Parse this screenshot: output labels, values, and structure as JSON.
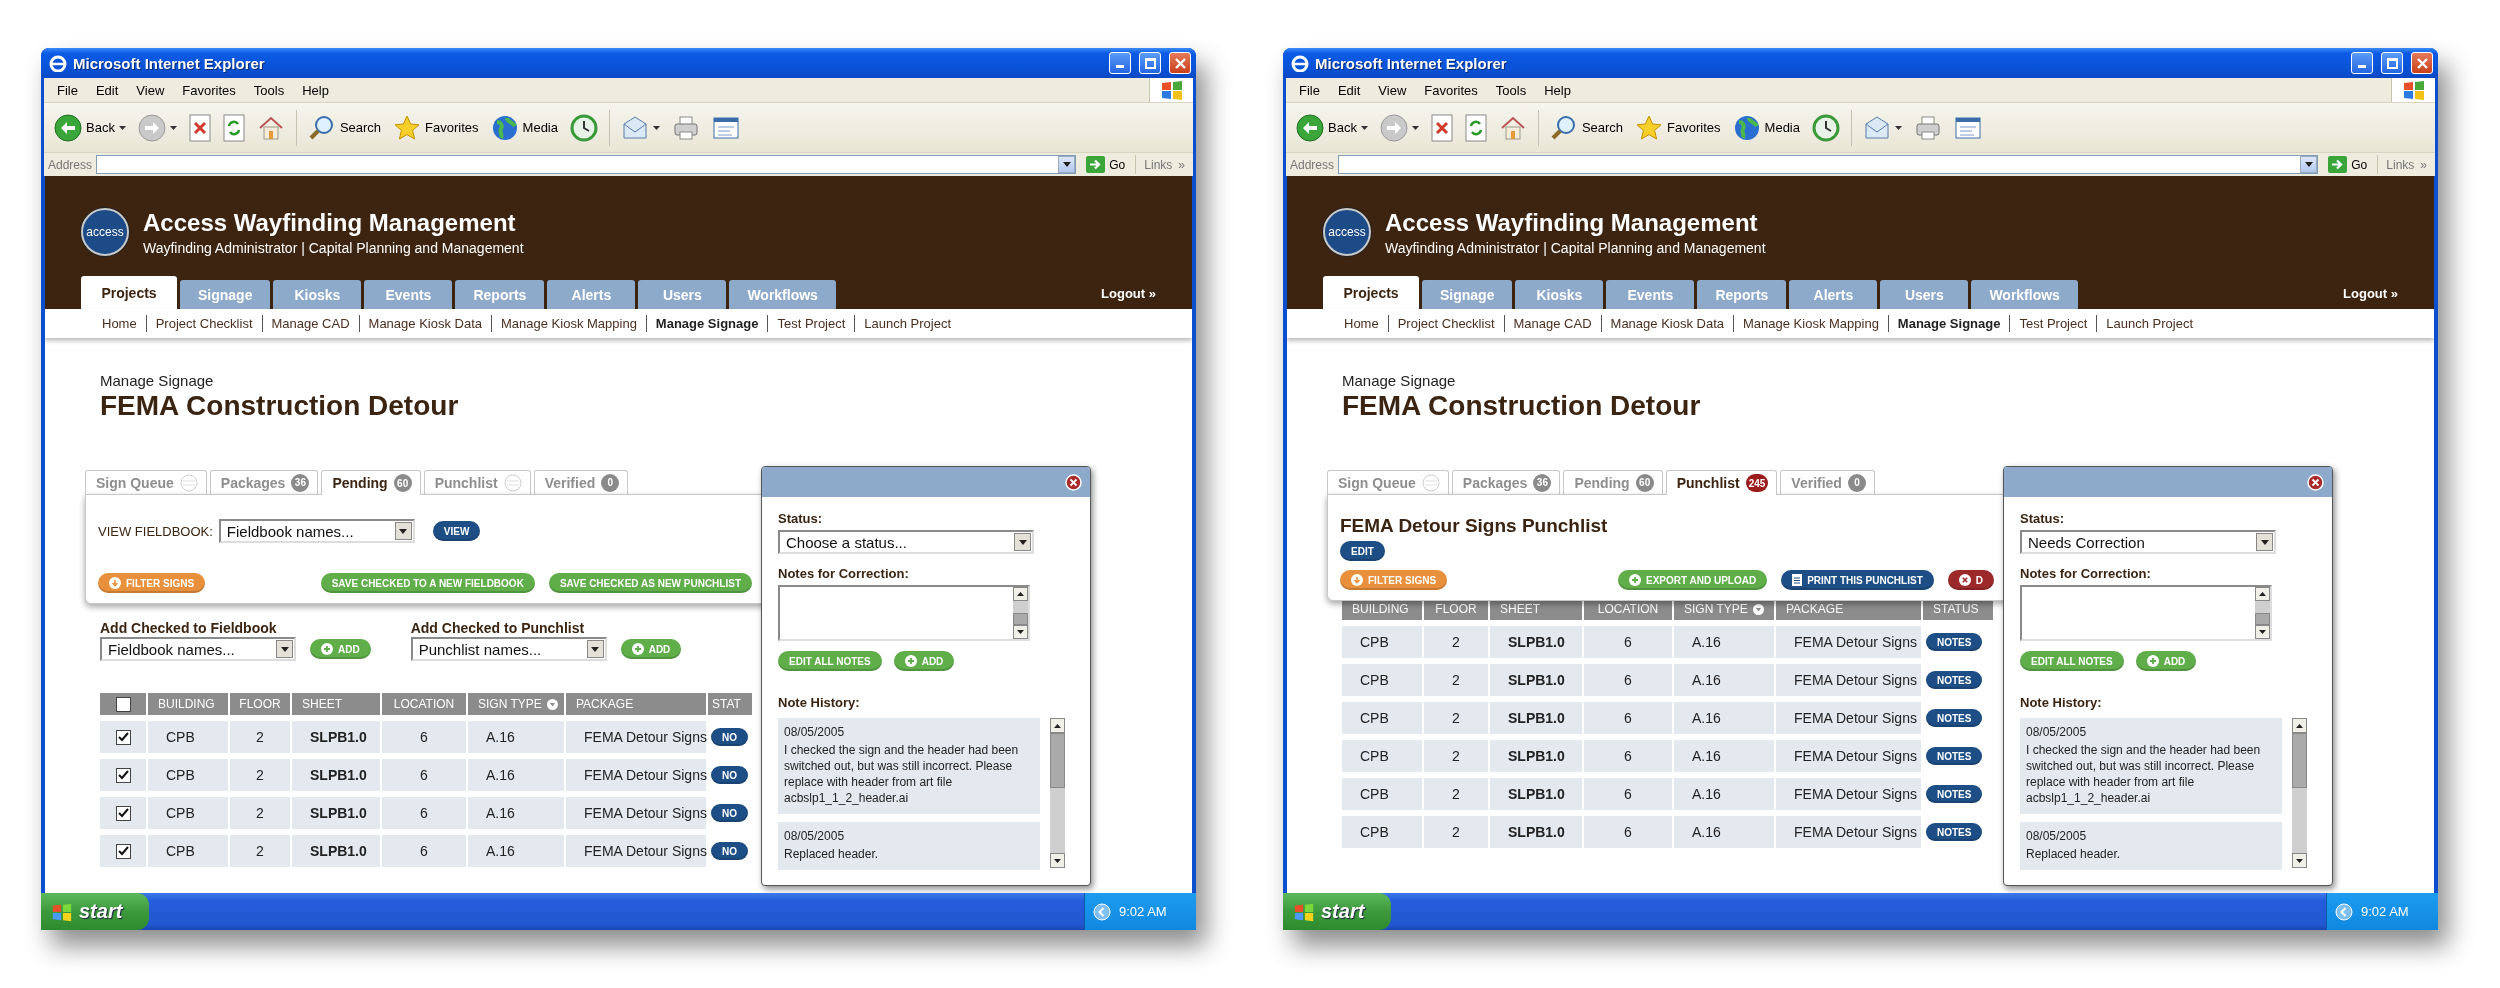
{
  "screens": [
    {
      "window": {
        "title": "Microsoft Internet Explorer"
      },
      "menu": [
        "File",
        "Edit",
        "View",
        "Favorites",
        "Tools",
        "Help"
      ],
      "toolbar": [
        {
          "kind": "back",
          "label": "Back"
        },
        {
          "kind": "forward"
        },
        {
          "kind": "stop"
        },
        {
          "kind": "refresh"
        },
        {
          "kind": "home"
        },
        {
          "kind": "separator"
        },
        {
          "kind": "search",
          "label": "Search"
        },
        {
          "kind": "favorites",
          "label": "Favorites"
        },
        {
          "kind": "media",
          "label": "Media"
        },
        {
          "kind": "history"
        },
        {
          "kind": "separator"
        },
        {
          "kind": "mail"
        },
        {
          "kind": "print"
        },
        {
          "kind": "edit"
        }
      ],
      "address": {
        "label": "Address",
        "go": "Go",
        "links": "Links",
        "more": "»"
      },
      "site": {
        "logo": "access",
        "title": "Access Wayfinding Management",
        "subtitle": "Wayfinding Administrator | Capital Planning and Management",
        "nav": [
          {
            "label": "Projects",
            "selected": true
          },
          {
            "label": "Signage",
            "selected": false
          },
          {
            "label": "Kiosks",
            "selected": false
          },
          {
            "label": "Events",
            "selected": false
          },
          {
            "label": "Reports",
            "selected": false
          },
          {
            "label": "Alerts",
            "selected": false
          },
          {
            "label": "Users",
            "selected": false
          },
          {
            "label": "Workflows",
            "selected": false
          }
        ],
        "logout": "Logout »",
        "subnav": [
          {
            "label": "Home",
            "selected": false
          },
          {
            "label": "Project Checklist",
            "selected": false
          },
          {
            "label": "Manage CAD",
            "selected": false
          },
          {
            "label": "Manage Kiosk Data",
            "selected": false
          },
          {
            "label": "Manage Kiosk Mapping",
            "selected": false
          },
          {
            "label": "Manage Signage",
            "selected": true
          },
          {
            "label": "Test Project",
            "selected": false
          },
          {
            "label": "Launch Project",
            "selected": false
          }
        ]
      },
      "page": {
        "breadcrumb": "Manage Signage",
        "title": "FEMA Construction Detour"
      },
      "tabs": [
        {
          "label": "Sign Queue",
          "selected": false
        },
        {
          "label": "Packages",
          "badge": "36",
          "color": "#8a8a8a",
          "selected": false
        },
        {
          "label": "Pending",
          "badge": "60",
          "color": "#8a8a8a",
          "selected": true
        },
        {
          "label": "Punchlist",
          "selected": false
        },
        {
          "label": "Verified",
          "badge": "0",
          "color": "#8a8a8a",
          "selected": false
        }
      ],
      "panel": {
        "kind": "fieldbook",
        "view_label": "VIEW FIELDBOOK:",
        "select": "Fieldbook names...",
        "view_button": "VIEW",
        "buttons": [
          {
            "kind": "filter",
            "label": "FILTER SIGNS"
          },
          {
            "kind": "save",
            "label": "SAVE CHECKED TO A NEW FIELDBOOK"
          },
          {
            "kind": "save",
            "label": "SAVE CHECKED AS NEW PUNCHLIST"
          }
        ]
      },
      "add_checked": [
        {
          "label": "Add Checked to Fieldbook",
          "select": "Fieldbook names...",
          "button": "ADD"
        },
        {
          "label": "Add Checked to Punchlist",
          "select": "Punchlist names...",
          "button": "ADD"
        }
      ],
      "table": {
        "select_all": {
          "checked": false
        },
        "columns": [
          {
            "label": "BUILDING",
            "sorted": false
          },
          {
            "label": "FLOOR",
            "sorted": false
          },
          {
            "label": "SHEET",
            "sorted": false
          },
          {
            "label": "LOCATION",
            "sorted": false
          },
          {
            "label": "SIGN TYPE",
            "sorted": true
          },
          {
            "label": "PACKAGE",
            "sorted": false
          },
          {
            "label": "STAT",
            "sorted": false
          }
        ],
        "rows": [
          {
            "checked": true,
            "cells": [
              "CPB",
              "2",
              "SLPB1.0",
              "6",
              "A.16",
              "FEMA Detour Signs"
            ],
            "status": "NO"
          },
          {
            "checked": true,
            "cells": [
              "CPB",
              "2",
              "SLPB1.0",
              "6",
              "A.16",
              "FEMA Detour Signs"
            ],
            "status": "NO"
          },
          {
            "checked": true,
            "cells": [
              "CPB",
              "2",
              "SLPB1.0",
              "6",
              "A.16",
              "FEMA Detour Signs"
            ],
            "status": "NO"
          },
          {
            "checked": true,
            "cells": [
              "CPB",
              "2",
              "SLPB1.0",
              "6",
              "A.16",
              "FEMA Detour Signs"
            ],
            "status": "NO"
          }
        ]
      },
      "popup": {
        "status_label": "Status:",
        "status_value": "Choose a status...",
        "notes_label": "Notes for Correction:",
        "buttons": [
          {
            "kind": "save",
            "label": "EDIT ALL NOTES"
          },
          {
            "kind": "add",
            "label": "ADD"
          }
        ],
        "history_label": "Note History:",
        "notes": [
          {
            "date": "08/05/2005",
            "text": "I checked the sign and the header had been switched out, but was still incorrect. Please replace with header from art file acbslp1_1_2_header.ai"
          },
          {
            "date": "08/05/2005",
            "text": "Replaced header."
          }
        ]
      },
      "taskbar": {
        "start": "start",
        "clock": "9:02 AM"
      }
    },
    {
      "window": {
        "title": "Microsoft Internet Explorer"
      },
      "menu": [
        "File",
        "Edit",
        "View",
        "Favorites",
        "Tools",
        "Help"
      ],
      "toolbar": [
        {
          "kind": "back",
          "label": "Back"
        },
        {
          "kind": "forward"
        },
        {
          "kind": "stop"
        },
        {
          "kind": "refresh"
        },
        {
          "kind": "home"
        },
        {
          "kind": "separator"
        },
        {
          "kind": "search",
          "label": "Search"
        },
        {
          "kind": "favorites",
          "label": "Favorites"
        },
        {
          "kind": "media",
          "label": "Media"
        },
        {
          "kind": "history"
        },
        {
          "kind": "separator"
        },
        {
          "kind": "mail"
        },
        {
          "kind": "print"
        },
        {
          "kind": "edit"
        }
      ],
      "address": {
        "label": "Address",
        "go": "Go",
        "links": "Links",
        "more": "»"
      },
      "site": {
        "logo": "access",
        "title": "Access Wayfinding Management",
        "subtitle": "Wayfinding Administrator | Capital Planning and Management",
        "nav": [
          {
            "label": "Projects",
            "selected": true
          },
          {
            "label": "Signage",
            "selected": false
          },
          {
            "label": "Kiosks",
            "selected": false
          },
          {
            "label": "Events",
            "selected": false
          },
          {
            "label": "Reports",
            "selected": false
          },
          {
            "label": "Alerts",
            "selected": false
          },
          {
            "label": "Users",
            "selected": false
          },
          {
            "label": "Workflows",
            "selected": false
          }
        ],
        "logout": "Logout »",
        "subnav": [
          {
            "label": "Home",
            "selected": false
          },
          {
            "label": "Project Checklist",
            "selected": false
          },
          {
            "label": "Manage CAD",
            "selected": false
          },
          {
            "label": "Manage Kiosk Data",
            "selected": false
          },
          {
            "label": "Manage Kiosk Mapping",
            "selected": false
          },
          {
            "label": "Manage Signage",
            "selected": true
          },
          {
            "label": "Test Project",
            "selected": false
          },
          {
            "label": "Launch Project",
            "selected": false
          }
        ]
      },
      "page": {
        "breadcrumb": "Manage Signage",
        "title": "FEMA Construction Detour"
      },
      "tabs": [
        {
          "label": "Sign Queue",
          "selected": false
        },
        {
          "label": "Packages",
          "badge": "36",
          "color": "#8a8a8a",
          "selected": false
        },
        {
          "label": "Pending",
          "badge": "60",
          "color": "#8a8a8a",
          "selected": false
        },
        {
          "label": "Punchlist",
          "badge": "245",
          "color": "#9b1c1c",
          "selected": true
        },
        {
          "label": "Verified",
          "badge": "0",
          "color": "#8a8a8a",
          "selected": false
        }
      ],
      "panel": {
        "kind": "punchlist",
        "title": "FEMA Detour Signs Punchlist",
        "edit_button": "EDIT",
        "buttons": [
          {
            "kind": "filter",
            "label": "FILTER SIGNS"
          },
          {
            "kind": "add",
            "label": "EXPORT AND UPLOAD"
          },
          {
            "kind": "print",
            "label": "PRINT THIS PUNCHLIST"
          },
          {
            "kind": "delete",
            "label": "D"
          }
        ]
      },
      "table": {
        "columns": [
          {
            "label": "BUILDING",
            "sorted": false
          },
          {
            "label": "FLOOR",
            "sorted": false
          },
          {
            "label": "SHEET",
            "sorted": false
          },
          {
            "label": "LOCATION",
            "sorted": false
          },
          {
            "label": "SIGN TYPE",
            "sorted": true
          },
          {
            "label": "PACKAGE",
            "sorted": false
          },
          {
            "label": "STATUS",
            "sorted": false
          }
        ],
        "rows": [
          {
            "cells": [
              "CPB",
              "2",
              "SLPB1.0",
              "6",
              "A.16",
              "FEMA Detour Signs"
            ],
            "status": "NOTES"
          },
          {
            "cells": [
              "CPB",
              "2",
              "SLPB1.0",
              "6",
              "A.16",
              "FEMA Detour Signs"
            ],
            "status": "NOTES"
          },
          {
            "cells": [
              "CPB",
              "2",
              "SLPB1.0",
              "6",
              "A.16",
              "FEMA Detour Signs"
            ],
            "status": "NOTES"
          },
          {
            "cells": [
              "CPB",
              "2",
              "SLPB1.0",
              "6",
              "A.16",
              "FEMA Detour Signs"
            ],
            "status": "NOTES"
          },
          {
            "cells": [
              "CPB",
              "2",
              "SLPB1.0",
              "6",
              "A.16",
              "FEMA Detour Signs"
            ],
            "status": "NOTES"
          },
          {
            "cells": [
              "CPB",
              "2",
              "SLPB1.0",
              "6",
              "A.16",
              "FEMA Detour Signs"
            ],
            "status": "NOTES"
          }
        ]
      },
      "popup": {
        "status_label": "Status:",
        "status_value": "Needs Correction",
        "notes_label": "Notes for Correction:",
        "buttons": [
          {
            "kind": "save",
            "label": "EDIT ALL NOTES"
          },
          {
            "kind": "add",
            "label": "ADD"
          }
        ],
        "history_label": "Note History:",
        "notes": [
          {
            "date": "08/05/2005",
            "text": "I checked the sign and the header had been switched out, but was still incorrect. Please replace with header from art file acbslp1_1_2_header.ai"
          },
          {
            "date": "08/05/2005",
            "text": "Replaced header."
          }
        ]
      },
      "taskbar": {
        "start": "start",
        "clock": "9:02 AM"
      }
    }
  ]
}
